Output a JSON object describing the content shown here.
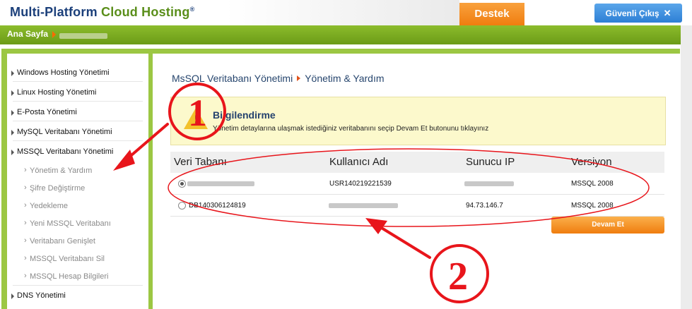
{
  "header": {
    "brand_primary": "Multi-Platform",
    "brand_secondary": "Cloud Hosting",
    "brand_mark": "®",
    "support_label": "Destek",
    "logout_label": "Güvenli Çıkış",
    "logout_icon": "close-icon"
  },
  "breadcrumb": {
    "home": "Ana Sayfa"
  },
  "sidebar": {
    "items": [
      {
        "label": "Windows Hosting Yönetimi"
      },
      {
        "label": "Linux Hosting Yönetimi"
      },
      {
        "label": "E-Posta Yönetimi"
      },
      {
        "label": "MySQL Veritabanı Yönetimi"
      },
      {
        "label": "MSSQL Veritabanı Yönetimi"
      },
      {
        "label": "DNS Yönetimi"
      }
    ],
    "mssql_sub": [
      {
        "label": "Yönetim & Yardım"
      },
      {
        "label": "Şifre Değiştirme"
      },
      {
        "label": "Yedekleme"
      },
      {
        "label": "Yeni MSSQL Veritabanı"
      },
      {
        "label": "Veritabanı Genişlet"
      },
      {
        "label": "MSSQL Veritabanı Sil"
      },
      {
        "label": "MSSQL Hesap Bilgileri"
      }
    ]
  },
  "page": {
    "title_part1": "MsSQL Veritabanı Yönetimi",
    "title_part2": "Yönetim & Yardım"
  },
  "info": {
    "title": "Bilgilendirme",
    "message": "Yönetim detaylarına ulaşmak istediğiniz veritabanını seçip Devam Et butonunu tıklayınız",
    "icon": "warning-icon"
  },
  "table": {
    "headers": [
      "Veri Tabanı",
      "Kullanıcı Adı",
      "Sunucu IP",
      "Versiyon"
    ],
    "rows": [
      {
        "db": "",
        "user": "USR140219221539",
        "ip": "",
        "version": "MSSQL 2008",
        "selected": true
      },
      {
        "db": "DB140306124819",
        "user": "",
        "ip": "94.73.146.7",
        "version": "MSSQL 2008",
        "selected": false
      }
    ]
  },
  "continue_label": "Devam Et",
  "annotations": {
    "marker1": "1",
    "marker2": "2",
    "color": "#e8151b"
  }
}
